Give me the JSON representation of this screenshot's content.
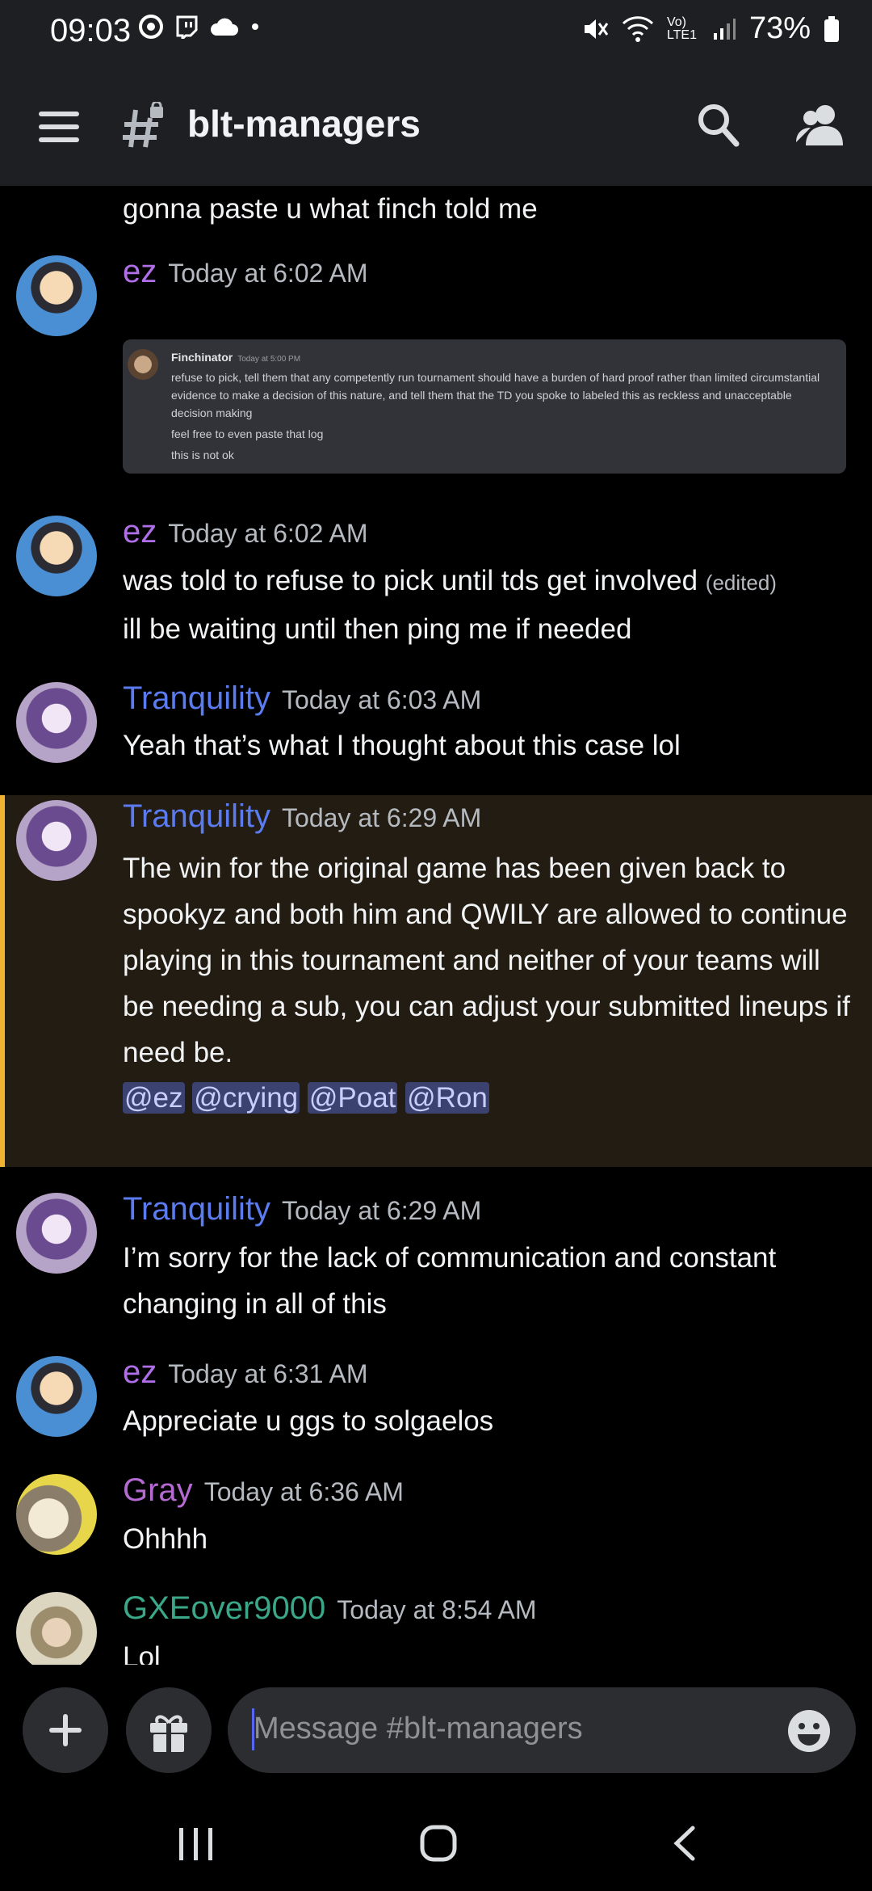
{
  "status_bar": {
    "time": "09:03",
    "battery": "73%",
    "network_label": "Vo) LTE1"
  },
  "header": {
    "channel_name": "blt-managers"
  },
  "messages": [
    {
      "id": "cont-top",
      "text": "gonna paste u what finch told me"
    },
    {
      "id": "m1",
      "author": "ez",
      "timestamp": "Today at 6:02 AM",
      "embed": {
        "author": "Finchinator",
        "timestamp": "Today at 5:00 PM",
        "lines": [
          "refuse to pick, tell them that any competently run tournament should have a burden of hard proof rather than limited circumstantial evidence to make a decision of this nature, and tell them that the TD you spoke to labeled this as reckless and unacceptable decision making",
          "feel free to even paste that log",
          "this is not ok"
        ]
      }
    },
    {
      "id": "m2",
      "author": "ez",
      "timestamp": "Today at 6:02 AM",
      "text": "was told to refuse to pick until tds get involved",
      "edited": "(edited)",
      "text2": "ill be waiting until then ping me if needed"
    },
    {
      "id": "m3",
      "author": "Tranquility",
      "timestamp": "Today at 6:03 AM",
      "text": "Yeah that’s what I thought about this case lol"
    },
    {
      "id": "m4",
      "author": "Tranquility",
      "timestamp": "Today at 6:29 AM",
      "text": "The win for the original game has been given back to spookyz and both him and QWILY are allowed to continue playing in this tournament and neither of your teams will be needing a sub, you can adjust your submitted lineups if need be.",
      "mentions": [
        "@ez",
        "@crying",
        "@Poat",
        "@Ron"
      ]
    },
    {
      "id": "m5",
      "author": "Tranquility",
      "timestamp": "Today at 6:29 AM",
      "text": "I’m sorry for the lack of communication and constant changing in all of this"
    },
    {
      "id": "m6",
      "author": "ez",
      "timestamp": "Today at 6:31 AM",
      "text": "Appreciate u ggs to solgaelos"
    },
    {
      "id": "m7",
      "author": "Gray",
      "timestamp": "Today at 6:36 AM",
      "text": "Ohhhh"
    },
    {
      "id": "m8",
      "author": "GXEover9000",
      "timestamp": "Today at 8:54 AM",
      "text": "Lol"
    }
  ],
  "composer": {
    "placeholder": "Message #blt-managers"
  },
  "colors": {
    "ez": "#b06ee8",
    "Tranquility": "#5b7cf0",
    "Gray": "#b56ad1",
    "GXEover9000": "#3aa888",
    "highlight_border": "#f0b232"
  },
  "icons": [
    "menu-icon",
    "hash-lock-icon",
    "search-icon",
    "members-icon",
    "plus-icon",
    "gift-icon",
    "emoji-icon",
    "recents-icon",
    "home-icon",
    "back-icon"
  ]
}
